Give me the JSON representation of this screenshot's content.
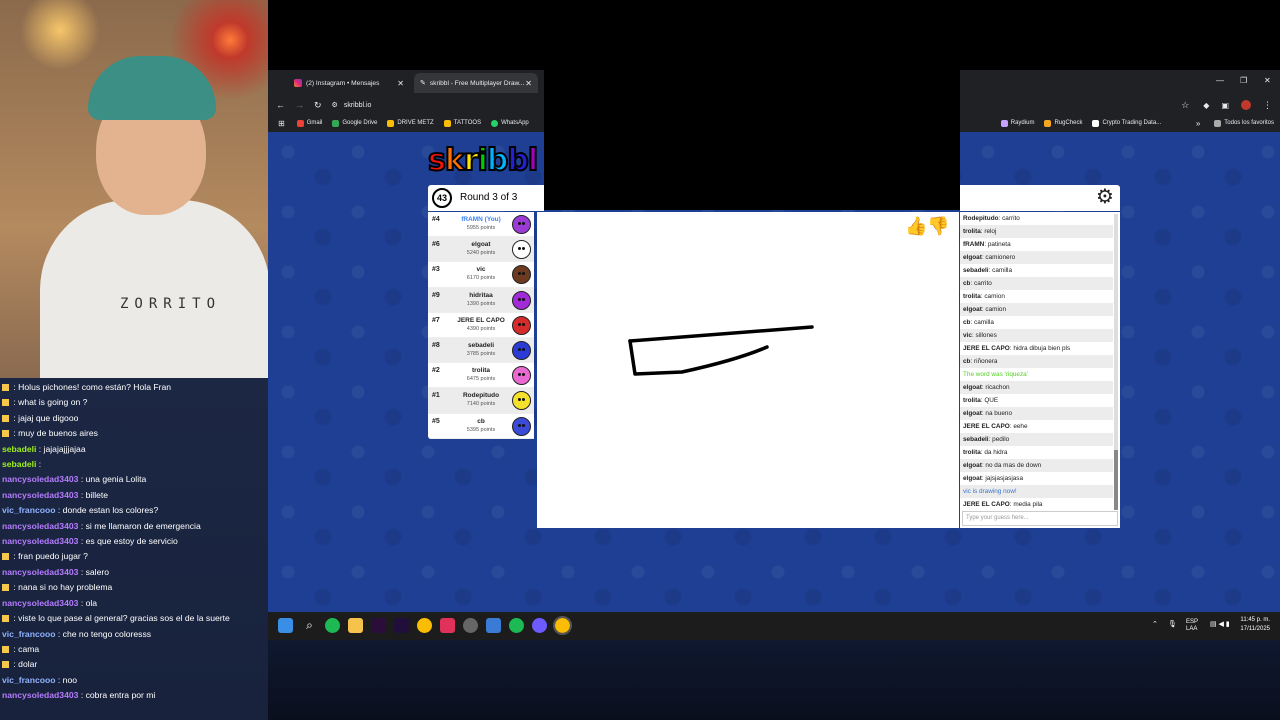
{
  "webcam": {
    "shirt_text": "ZORRITO"
  },
  "stream_chat": [
    {
      "user": "",
      "text": "Holus pichones! como están? Hola Fran",
      "color": "#f5c84c",
      "badge": true
    },
    {
      "user": "",
      "text": "what is going on ?",
      "color": "#f5c84c",
      "badge": true
    },
    {
      "user": "",
      "text": "jajaj que digooo",
      "color": "#f5c84c",
      "badge": true
    },
    {
      "user": "",
      "text": "muy de buenos aires",
      "color": "#f5c84c",
      "badge": true
    },
    {
      "user": "sebadeli",
      "text": "jajajajjjajaa",
      "color": "#9ef01a",
      "badge": false
    },
    {
      "user": "sebadeli",
      "text": "",
      "color": "#9ef01a",
      "badge": false
    },
    {
      "user": "nancysoledad3403",
      "text": "una genia Lolita",
      "color": "#b57cff",
      "badge": false
    },
    {
      "user": "nancysoledad3403",
      "text": "billete",
      "color": "#b57cff",
      "badge": false
    },
    {
      "user": "vic_francooo",
      "text": "donde estan los colores?",
      "color": "#8fb3ff",
      "badge": false
    },
    {
      "user": "nancysoledad3403",
      "text": "si me llamaron de emergencia",
      "color": "#b57cff",
      "badge": false
    },
    {
      "user": "nancysoledad3403",
      "text": "es que estoy de servicio",
      "color": "#b57cff",
      "badge": false
    },
    {
      "user": "",
      "text": "fran puedo jugar ?",
      "color": "#f5c84c",
      "badge": true
    },
    {
      "user": "nancysoledad3403",
      "text": "salero",
      "color": "#b57cff",
      "badge": false
    },
    {
      "user": "",
      "text": "nana si no hay problema",
      "color": "#f5c84c",
      "badge": true
    },
    {
      "user": "nancysoledad3403",
      "text": "ola",
      "color": "#b57cff",
      "badge": false
    },
    {
      "user": "",
      "text": "viste lo que pase al general? gracias sos el de la suerte",
      "color": "#f5c84c",
      "badge": true
    },
    {
      "user": "vic_francooo",
      "text": "che no tengo coloresss",
      "color": "#8fb3ff",
      "badge": false
    },
    {
      "user": "",
      "text": "cama",
      "color": "#f5c84c",
      "badge": true
    },
    {
      "user": "",
      "text": "dolar",
      "color": "#f5c84c",
      "badge": true
    },
    {
      "user": "vic_francooo",
      "text": "noo",
      "color": "#8fb3ff",
      "badge": false
    },
    {
      "user": "nancysoledad3403",
      "text": "cobra entra por mi",
      "color": "#b57cff",
      "badge": false
    }
  ],
  "browser": {
    "tabs": [
      {
        "label": "(2) Instagram • Mensajes",
        "active": false
      },
      {
        "label": "skribbl - Free Multiplayer Draw...",
        "active": true
      }
    ],
    "url": "skribbl.io",
    "bookmarks": [
      "Gmail",
      "Google Drive",
      "DRIVE METZ",
      "TATTOOS",
      "WhatsApp"
    ],
    "bookmarks_right": [
      "Raydium",
      "RugCheck",
      "Crypto Trading Data..."
    ],
    "all_favorites": "Todos los favoritos"
  },
  "game": {
    "logo": "skribbl",
    "timer": "43",
    "round": "Round 3 of 3",
    "players": [
      {
        "rank": "#4",
        "name": "fRAMN (You)",
        "points": "5955 points",
        "you": true,
        "color": "#9b3bd6"
      },
      {
        "rank": "#6",
        "name": "elgoat",
        "points": "5240 points",
        "you": false,
        "color": "#ffffff"
      },
      {
        "rank": "#3",
        "name": "vic",
        "points": "6170 points",
        "you": false,
        "color": "#6b3a1f"
      },
      {
        "rank": "#9",
        "name": "hidritaa",
        "points": "1390 points",
        "you": false,
        "color": "#a12bd6"
      },
      {
        "rank": "#7",
        "name": "JERE EL CAPO",
        "points": "4390 points",
        "you": false,
        "color": "#d62b2b"
      },
      {
        "rank": "#8",
        "name": "sebadeli",
        "points": "3785 points",
        "you": false,
        "color": "#2b3bd6"
      },
      {
        "rank": "#2",
        "name": "trolita",
        "points": "6475 points",
        "you": false,
        "color": "#e86ad0"
      },
      {
        "rank": "#1",
        "name": "Rodepitudo",
        "points": "7140 points",
        "you": false,
        "color": "#f5e02b"
      },
      {
        "rank": "#5",
        "name": "cb",
        "points": "5395 points",
        "you": false,
        "color": "#3b4bd6"
      }
    ],
    "chat": [
      {
        "user": "Rodepitudo",
        "text": "carrito",
        "type": "normal"
      },
      {
        "user": "trolita",
        "text": "reloj",
        "type": "normal"
      },
      {
        "user": "fRAMN",
        "text": "patineta",
        "type": "normal"
      },
      {
        "user": "elgoat",
        "text": "camionero",
        "type": "normal"
      },
      {
        "user": "sebadeli",
        "text": "camilla",
        "type": "normal"
      },
      {
        "user": "cb",
        "text": "carrito",
        "type": "normal"
      },
      {
        "user": "trolita",
        "text": "camion",
        "type": "normal"
      },
      {
        "user": "elgoat",
        "text": "camion",
        "type": "normal"
      },
      {
        "user": "cb",
        "text": "camilla",
        "type": "normal"
      },
      {
        "user": "vic",
        "text": "sillones",
        "type": "normal"
      },
      {
        "user": "JERE EL CAPO",
        "text": "hidra dibuja bien pls",
        "type": "normal"
      },
      {
        "user": "cb",
        "text": "riñonera",
        "type": "normal"
      },
      {
        "user": "",
        "text": "The word was 'riqueza'",
        "type": "green"
      },
      {
        "user": "elgoat",
        "text": "ricachon",
        "type": "normal"
      },
      {
        "user": "trolita",
        "text": "QUE",
        "type": "normal"
      },
      {
        "user": "elgoat",
        "text": "na bueno",
        "type": "normal"
      },
      {
        "user": "JERE EL CAPO",
        "text": "eehe",
        "type": "normal"
      },
      {
        "user": "sebadeli",
        "text": "pedilo",
        "type": "normal"
      },
      {
        "user": "trolita",
        "text": "da hidra",
        "type": "normal"
      },
      {
        "user": "elgoat",
        "text": "no da mas de down",
        "type": "normal"
      },
      {
        "user": "elgoat",
        "text": "jajsjasjasjasa",
        "type": "normal"
      },
      {
        "user": "",
        "text": "vic is drawing now!",
        "type": "blue"
      },
      {
        "user": "JERE EL CAPO",
        "text": "media pila",
        "type": "normal"
      }
    ],
    "guess_placeholder": "Type your guess here..."
  },
  "taskbar": {
    "lang": "ESP",
    "lang2": "LAA",
    "time": "11:45 p. m.",
    "date": "17/11/2025"
  }
}
